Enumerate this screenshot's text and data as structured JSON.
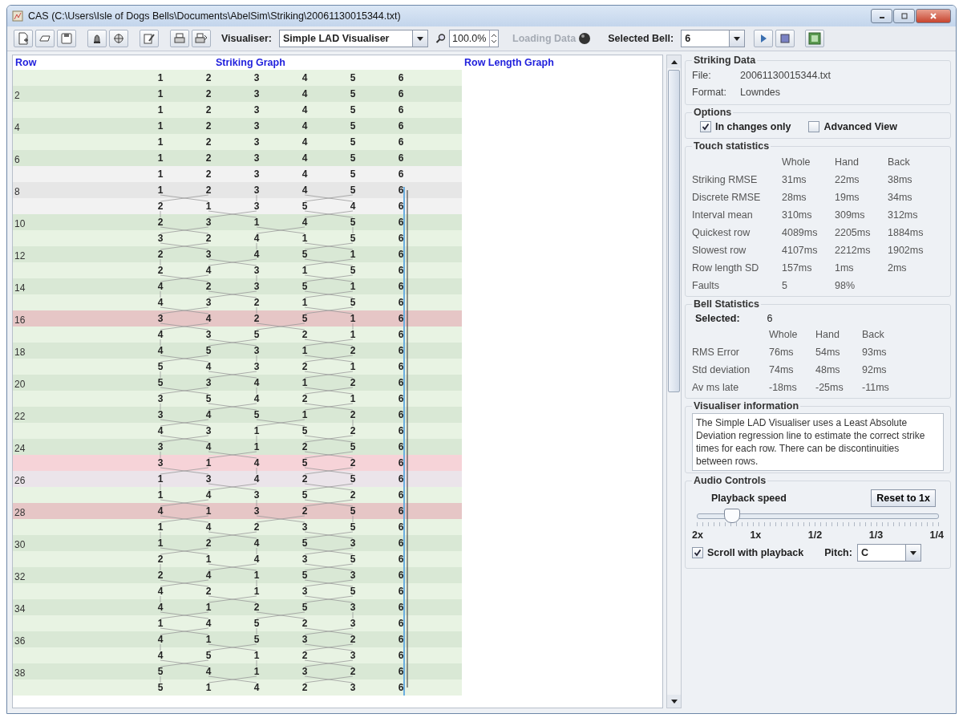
{
  "window": {
    "title": "CAS (C:\\Users\\Isle of Dogs Bells\\Documents\\AbelSim\\Striking\\20061130015344.txt)"
  },
  "toolbar": {
    "visualiser_label": "Visualiser:",
    "visualiser": "Simple LAD Visualiser",
    "zoom": "100.0%",
    "loading": {
      "label": "Loading Data",
      "disabled": true
    },
    "selected_bell_label": "Selected Bell:",
    "selected_bell": "6"
  },
  "graph": {
    "headers": {
      "row": "Row",
      "striking": "Striking Graph",
      "row_length": "Row Length Graph"
    },
    "rows": [
      {
        "bells": [
          "1",
          "2",
          "3",
          "4",
          "5",
          "6"
        ],
        "color": "#e8f3e3"
      },
      {
        "label": "2",
        "bells": [
          "1",
          "2",
          "3",
          "4",
          "5",
          "6"
        ],
        "color": "#d9e8d5"
      },
      {
        "bells": [
          "1",
          "2",
          "3",
          "4",
          "5",
          "6"
        ],
        "color": "#e8f3e3"
      },
      {
        "label": "4",
        "bells": [
          "1",
          "2",
          "3",
          "4",
          "5",
          "6"
        ],
        "color": "#d9e8d5"
      },
      {
        "bells": [
          "1",
          "2",
          "3",
          "4",
          "5",
          "6"
        ],
        "color": "#e8f3e3"
      },
      {
        "label": "6",
        "bells": [
          "1",
          "2",
          "3",
          "4",
          "5",
          "6"
        ],
        "color": "#d9e8d5"
      },
      {
        "bells": [
          "1",
          "2",
          "3",
          "4",
          "5",
          "6"
        ],
        "color": "#f2f2f2"
      },
      {
        "label": "8",
        "bells": [
          "1",
          "2",
          "3",
          "4",
          "5",
          "6"
        ],
        "color": "#e6e6e6"
      },
      {
        "bells": [
          "2",
          "1",
          "3",
          "5",
          "4",
          "6"
        ],
        "color": "#f2f2f2"
      },
      {
        "label": "10",
        "bells": [
          "2",
          "3",
          "1",
          "4",
          "5",
          "6"
        ],
        "color": "#d9e8d5"
      },
      {
        "bells": [
          "3",
          "2",
          "4",
          "1",
          "5",
          "6"
        ],
        "color": "#e8f3e3"
      },
      {
        "label": "12",
        "bells": [
          "2",
          "3",
          "4",
          "5",
          "1",
          "6"
        ],
        "color": "#d9e8d5"
      },
      {
        "bells": [
          "2",
          "4",
          "3",
          "1",
          "5",
          "6"
        ],
        "color": "#e8f3e3"
      },
      {
        "label": "14",
        "bells": [
          "4",
          "2",
          "3",
          "5",
          "1",
          "6"
        ],
        "color": "#d9e8d5"
      },
      {
        "bells": [
          "4",
          "3",
          "2",
          "1",
          "5",
          "6"
        ],
        "color": "#e8f3e3"
      },
      {
        "label": "16",
        "bells": [
          "3",
          "4",
          "2",
          "5",
          "1",
          "6"
        ],
        "color": "#e6c6c6"
      },
      {
        "bells": [
          "4",
          "3",
          "5",
          "2",
          "1",
          "6"
        ],
        "color": "#e8f3e3"
      },
      {
        "label": "18",
        "bells": [
          "4",
          "5",
          "3",
          "1",
          "2",
          "6"
        ],
        "color": "#d9e8d5"
      },
      {
        "bells": [
          "5",
          "4",
          "3",
          "2",
          "1",
          "6"
        ],
        "color": "#e8f3e3"
      },
      {
        "label": "20",
        "bells": [
          "5",
          "3",
          "4",
          "1",
          "2",
          "6"
        ],
        "color": "#d9e8d5"
      },
      {
        "bells": [
          "3",
          "5",
          "4",
          "2",
          "1",
          "6"
        ],
        "color": "#e8f3e3"
      },
      {
        "label": "22",
        "bells": [
          "3",
          "4",
          "5",
          "1",
          "2",
          "6"
        ],
        "color": "#d9e8d5"
      },
      {
        "bells": [
          "4",
          "3",
          "1",
          "5",
          "2",
          "6"
        ],
        "color": "#e8f3e3"
      },
      {
        "label": "24",
        "bells": [
          "3",
          "4",
          "1",
          "2",
          "5",
          "6"
        ],
        "color": "#d9e8d5"
      },
      {
        "bells": [
          "3",
          "1",
          "4",
          "5",
          "2",
          "6"
        ],
        "color": "#f6d3d8"
      },
      {
        "label": "26",
        "bells": [
          "1",
          "3",
          "4",
          "2",
          "5",
          "6"
        ],
        "color": "#ebe4ea"
      },
      {
        "bells": [
          "1",
          "4",
          "3",
          "5",
          "2",
          "6"
        ],
        "color": "#e8f3e3"
      },
      {
        "label": "28",
        "bells": [
          "4",
          "1",
          "3",
          "2",
          "5",
          "6"
        ],
        "color": "#e6c6c6"
      },
      {
        "bells": [
          "1",
          "4",
          "2",
          "3",
          "5",
          "6"
        ],
        "color": "#e8f3e3"
      },
      {
        "label": "30",
        "bells": [
          "1",
          "2",
          "4",
          "5",
          "3",
          "6"
        ],
        "color": "#d9e8d5"
      },
      {
        "bells": [
          "2",
          "1",
          "4",
          "3",
          "5",
          "6"
        ],
        "color": "#e8f3e3"
      },
      {
        "label": "32",
        "bells": [
          "2",
          "4",
          "1",
          "5",
          "3",
          "6"
        ],
        "color": "#d9e8d5"
      },
      {
        "bells": [
          "4",
          "2",
          "1",
          "3",
          "5",
          "6"
        ],
        "color": "#e8f3e3"
      },
      {
        "label": "34",
        "bells": [
          "4",
          "1",
          "2",
          "5",
          "3",
          "6"
        ],
        "color": "#d9e8d5"
      },
      {
        "bells": [
          "1",
          "4",
          "5",
          "2",
          "3",
          "6"
        ],
        "color": "#e8f3e3"
      },
      {
        "label": "36",
        "bells": [
          "4",
          "1",
          "5",
          "3",
          "2",
          "6"
        ],
        "color": "#d9e8d5"
      },
      {
        "bells": [
          "4",
          "5",
          "1",
          "2",
          "3",
          "6"
        ],
        "color": "#e8f3e3"
      },
      {
        "label": "38",
        "bells": [
          "5",
          "4",
          "1",
          "3",
          "2",
          "6"
        ],
        "color": "#d9e8d5"
      },
      {
        "bells": [
          "5",
          "1",
          "4",
          "2",
          "3",
          "6"
        ],
        "color": "#e8f3e3"
      }
    ]
  },
  "striking_data": {
    "title": "Striking Data",
    "fields": [
      {
        "label": "File:",
        "value": "20061130015344.txt"
      },
      {
        "label": "Format:",
        "value": "Lowndes"
      }
    ]
  },
  "options": {
    "title": "Options",
    "checkboxes": [
      {
        "label": "In changes only",
        "checked": true
      },
      {
        "label": "Advanced View",
        "checked": false
      }
    ]
  },
  "touch_statistics": {
    "title": "Touch statistics",
    "columns": [
      "Whole",
      "Hand",
      "Back"
    ],
    "rows": [
      {
        "label": "Striking RMSE",
        "values": [
          "31ms",
          "22ms",
          "38ms"
        ]
      },
      {
        "label": "Discrete RMSE",
        "values": [
          "28ms",
          "19ms",
          "34ms"
        ]
      },
      {
        "label": "Interval mean",
        "values": [
          "310ms",
          "309ms",
          "312ms"
        ]
      },
      {
        "label": "Quickest row",
        "values": [
          "4089ms",
          "2205ms",
          "1884ms"
        ]
      },
      {
        "label": "Slowest row",
        "values": [
          "4107ms",
          "2212ms",
          "1902ms"
        ]
      },
      {
        "label": "Row length SD",
        "values": [
          "157ms",
          "1ms",
          "2ms"
        ]
      },
      {
        "label": "Faults",
        "values": [
          "5",
          "98%"
        ]
      }
    ]
  },
  "bell_statistics": {
    "title": "Bell Statistics",
    "selected_label": "Selected:",
    "selected": "6",
    "columns": [
      "Whole",
      "Hand",
      "Back"
    ],
    "rows": [
      {
        "label": "RMS Error",
        "values": [
          "76ms",
          "54ms",
          "93ms"
        ]
      },
      {
        "label": "Std deviation",
        "values": [
          "74ms",
          "48ms",
          "92ms"
        ]
      },
      {
        "label": "Av ms late",
        "values": [
          "-18ms",
          "-25ms",
          "-11ms"
        ]
      }
    ]
  },
  "visualiser_information": {
    "title": "Visualiser information",
    "text": "The Simple LAD Visualiser uses a Least Absolute Deviation regression line to estimate the correct strike times for each row. There can be discontinuities between rows."
  },
  "audio_controls": {
    "title": "Audio Controls",
    "speed_label": "Playback speed",
    "reset_button": "Reset to 1x",
    "speed": {
      "level": 0.14
    },
    "speed_ticks": [
      "2x",
      "1x",
      "1/2",
      "1/3",
      "1/4"
    ],
    "scroll_with_playback": {
      "label": "Scroll with playback",
      "checked": true
    },
    "pitch_label": "Pitch:",
    "pitch": "C"
  }
}
